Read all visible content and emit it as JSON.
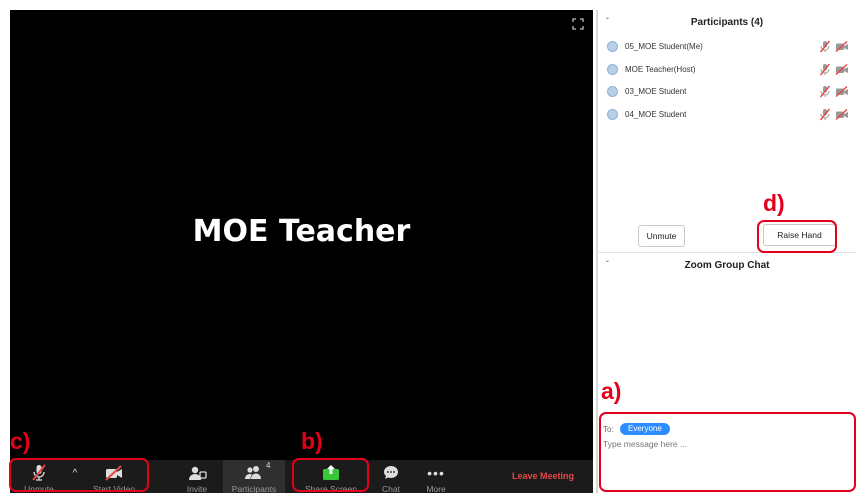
{
  "video": {
    "speaker_name": "MOE Teacher"
  },
  "toolbar": {
    "unmute_label": "Unmute",
    "start_video_label": "Start Video",
    "invite_label": "Invite",
    "participants_label": "Participants",
    "participants_count": "4",
    "share_screen_label": "Share Screen",
    "chat_label": "Chat",
    "more_label": "More",
    "leave_label": "Leave Meeting"
  },
  "participants_panel": {
    "title": "Participants (4)",
    "items": [
      {
        "name": "05_MOE Student(Me)"
      },
      {
        "name": "MOE Teacher(Host)"
      },
      {
        "name": "03_MOE Student"
      },
      {
        "name": "04_MOE Student"
      }
    ],
    "unmute_label": "Unmute",
    "raise_hand_label": "Raise Hand"
  },
  "chat_panel": {
    "title": "Zoom Group Chat",
    "to_label": "To:",
    "recipient": "Everyone",
    "placeholder": "Type message here ..."
  },
  "annotations": {
    "a": "a)",
    "b": "b)",
    "c": "c)",
    "d": "d)"
  },
  "colors": {
    "accent": "#2d8cff",
    "leave": "#e24848",
    "share": "#37c837",
    "annotation": "#e3001b"
  }
}
